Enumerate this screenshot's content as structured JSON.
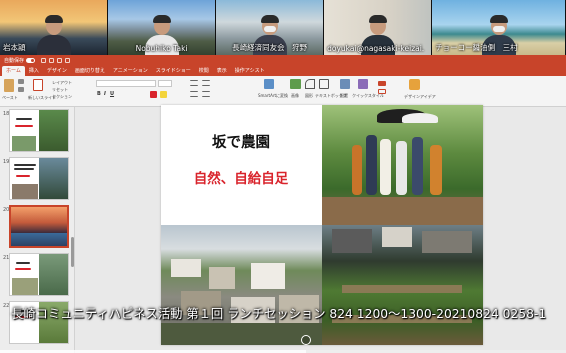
{
  "participants": [
    {
      "name": "岩本頴",
      "label_visible": true
    },
    {
      "name": "Nobuhiko Taki",
      "label_visible": true
    },
    {
      "name": "長崎経済同友会　狩野",
      "label_visible": true
    },
    {
      "name": "doyukai@nagasaki-keizai.",
      "label_visible": true
    },
    {
      "name": "チョーコー醤油側　三村",
      "label_visible": true
    }
  ],
  "ppt": {
    "autosave_label": "自動保存",
    "doc_title": "坂で農園",
    "tabs": [
      "ホーム",
      "挿入",
      "デザイン",
      "画面切り替え",
      "アニメーション",
      "スライドショー",
      "校閲",
      "表示",
      "操作アシスト"
    ],
    "active_tab": "ホーム",
    "ribbon": {
      "paste_label": "ペースト",
      "new_slide_label": "新しいスライド",
      "layout_label": "レイアウト",
      "reset_label": "リセット",
      "section_label": "セクション",
      "convert_label": "SmartArtに変換",
      "picture_label": "画像",
      "shape_label": "図形",
      "textbox_label": "テキストボックス",
      "arrange_label": "配置",
      "quickstyle_label": "クイックスタイル",
      "designer_label": "デザインアイデア"
    },
    "thumbnails": [
      {
        "num": "18",
        "title": "坂で農園",
        "subtitle": "自然、自給自足"
      },
      {
        "num": "19",
        "title": "",
        "subtitle": ""
      },
      {
        "num": "20",
        "title": "",
        "subtitle": ""
      },
      {
        "num": "21",
        "title": "",
        "subtitle": ""
      },
      {
        "num": "22",
        "title": "",
        "subtitle": ""
      }
    ]
  },
  "slide": {
    "title": "坂で農園",
    "subtitle": "自然、自給自足"
  },
  "caption": "長崎コミュニティハピネス活動 第１回 ランチセッション 824 1200～1300-20210824 0258-1",
  "progress": 0.54,
  "colors": {
    "ppt_accent": "#c8442a",
    "subtitle_red": "#d9242c"
  }
}
